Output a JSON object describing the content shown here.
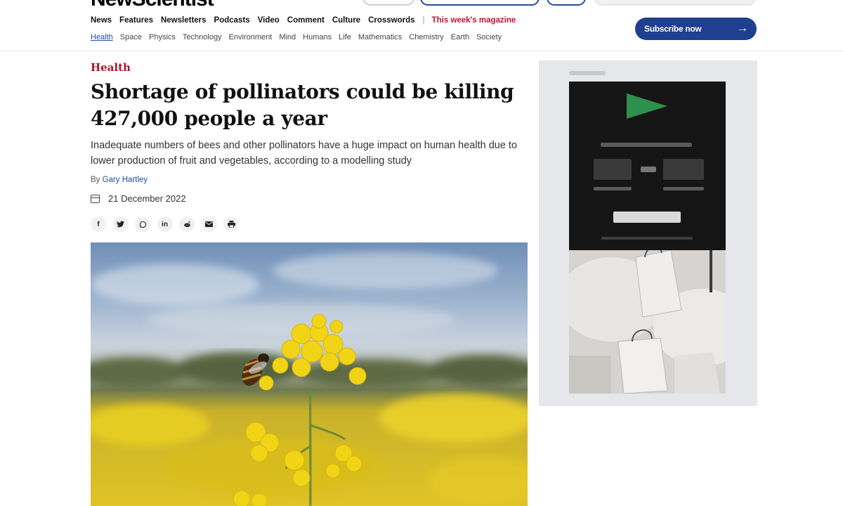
{
  "header": {
    "masthead": "NewScientist",
    "main_nav": [
      "News",
      "Features",
      "Newsletters",
      "Podcasts",
      "Video",
      "Comment",
      "Culture",
      "Crosswords"
    ],
    "separator": "|",
    "magazine_link": "This week's magazine",
    "sub_nav": [
      "Health",
      "Space",
      "Physics",
      "Technology",
      "Environment",
      "Mind",
      "Humans",
      "Life",
      "Mathematics",
      "Chemistry",
      "Earth",
      "Society"
    ],
    "active_sub_nav": "Health",
    "subscribe_label": "Subscribe now",
    "subscribe_icon": "arrow-right-icon"
  },
  "article": {
    "category": "Health",
    "headline": "Shortage of pollinators could be killing 427,000 people a year",
    "standfirst": "Inadequate numbers of bees and other pollinators have a huge impact on human health due to lower production of fruit and vegetables, according to a modelling study",
    "byline_prefix": "By",
    "author": "Gary Hartley",
    "date": "21 December 2022",
    "share_icons": [
      "facebook-icon",
      "twitter-icon",
      "whatsapp-icon",
      "linkedin-icon",
      "reddit-icon",
      "email-icon",
      "print-icon"
    ]
  },
  "colors": {
    "brand_red": "#c8102e",
    "link_blue": "#1f4fa3",
    "subscribe_bg": "#1f3f8f"
  }
}
